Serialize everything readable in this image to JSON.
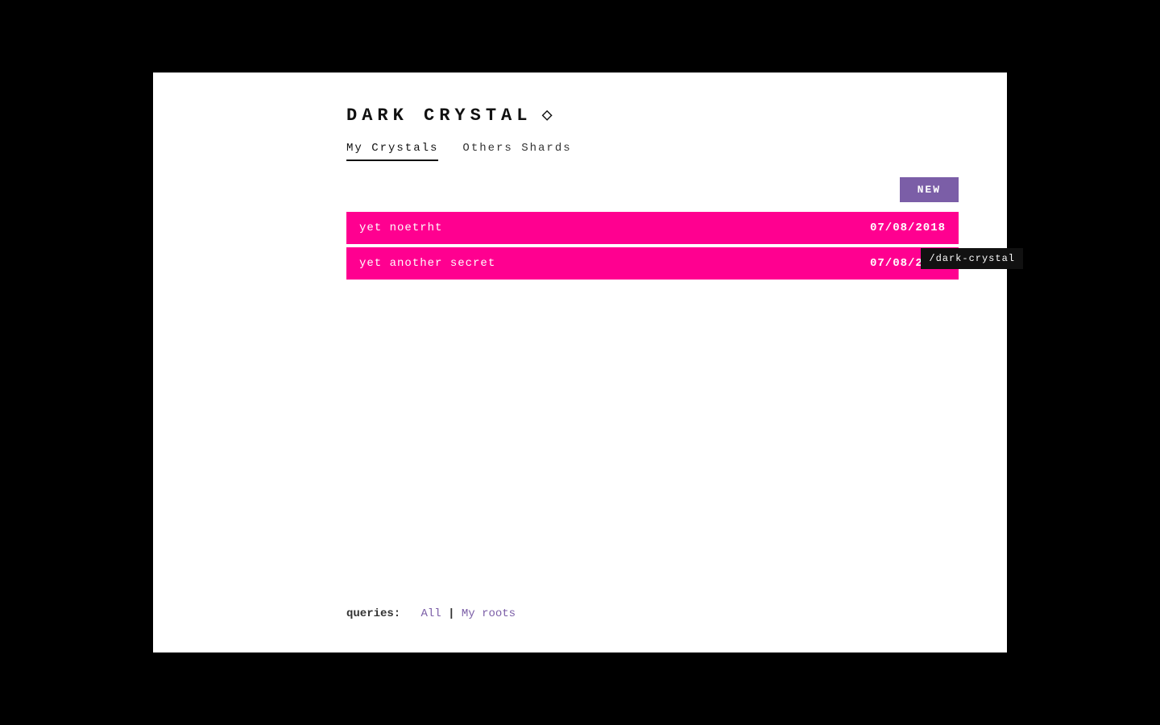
{
  "header": {
    "logo": "DARK  CRYSTAL",
    "diamond": "◇"
  },
  "tabs": [
    {
      "id": "my-crystals",
      "label": "My Crystals",
      "active": true
    },
    {
      "id": "others-shards",
      "label": "Others Shards",
      "active": false
    }
  ],
  "toolbar": {
    "new_button_label": "NEW"
  },
  "tooltip": {
    "text": "/dark-crystal"
  },
  "crystals": [
    {
      "name": "yet noetrht",
      "date": "07/08/2018"
    },
    {
      "name": "yet another secret",
      "date": "07/08/2018"
    }
  ],
  "footer": {
    "label": "queries:",
    "links": [
      {
        "text": "All",
        "id": "all"
      },
      {
        "separator": "|"
      },
      {
        "text": "My roots",
        "id": "my-roots"
      }
    ]
  }
}
